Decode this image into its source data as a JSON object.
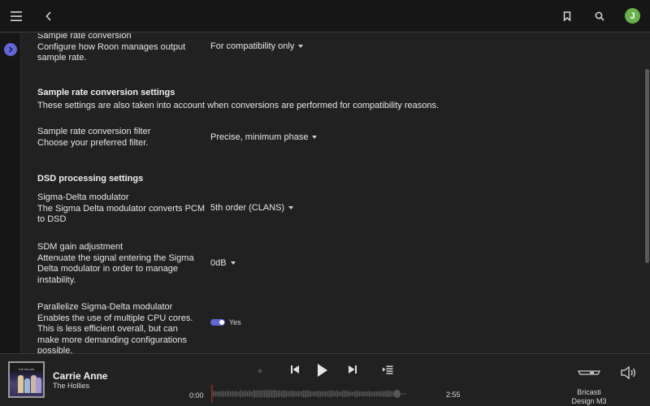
{
  "topbar": {
    "icons": [
      "hamburger-menu-icon",
      "back-chevron-icon",
      "bookmark-icon",
      "search-icon"
    ],
    "avatar_initial": "J",
    "avatar_color": "#6ab04c"
  },
  "sidebar": {
    "toggle_icon": "chevron-right-icon",
    "accent": "#6366d4"
  },
  "settings": {
    "src": {
      "label": "Sample rate conversion",
      "description": "Configure how Roon manages output sample rate.",
      "value": "For compatibility only"
    },
    "src_section": {
      "title": "Sample rate conversion settings",
      "description": "These settings are also taken into account when conversions are performed for compatibility reasons."
    },
    "src_filter": {
      "label": "Sample rate conversion filter",
      "description": "Choose your preferred filter.",
      "value": "Precise, minimum phase"
    },
    "dsd_section": {
      "title": "DSD processing settings"
    },
    "sdm": {
      "label": "Sigma-Delta modulator",
      "description": "The Sigma Delta modulator converts PCM to DSD",
      "value": "5th order (CLANS)"
    },
    "sdm_gain": {
      "label": "SDM gain adjustment",
      "description": "Attenuate the signal entering the Sigma Delta modulator in order to manage instability.",
      "value": "0dB"
    },
    "parallel_sdm": {
      "label": "Parallelize Sigma-Delta modulator",
      "description": "Enables the use of multiple CPU cores. This is less efficient overall, but can make more demanding configurations possible.",
      "enabled": true,
      "value_label": "Yes"
    }
  },
  "player": {
    "album_art_text": "THE HOLLIES",
    "track_title": "Carrie Anne",
    "artist": "The Hollies",
    "elapsed": "0:00",
    "duration": "2:55",
    "progress": 0.0,
    "zone_name": "Bricasti Design M3",
    "progress_color": "#8a2a3a"
  }
}
